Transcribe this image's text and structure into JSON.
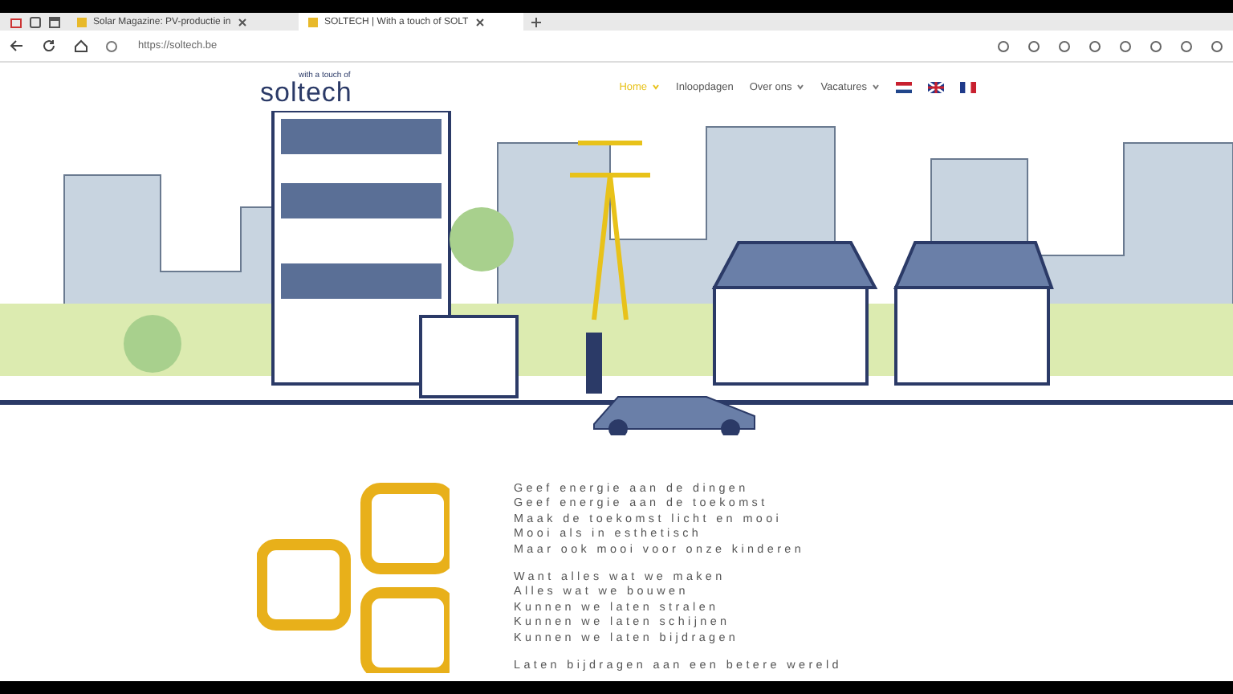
{
  "browser": {
    "tabs": [
      {
        "label": "Solar Magazine: PV-productie in",
        "selected": false
      },
      {
        "label": "SOLTECH | With a touch of SOLT",
        "selected": true
      }
    ],
    "url": "https://soltech.be"
  },
  "site": {
    "logo_tagline": "with a touch of",
    "logo_name": "soltech",
    "nav": [
      {
        "label": "Home",
        "selected": true,
        "dropdown": true
      },
      {
        "label": "Inloopdagen",
        "selected": false,
        "dropdown": false
      },
      {
        "label": "Over ons",
        "selected": false,
        "dropdown": true
      },
      {
        "label": "Vacatures",
        "selected": false,
        "dropdown": true
      }
    ],
    "languages": [
      {
        "kind": "nl"
      },
      {
        "kind": "gb"
      },
      {
        "kind": "fr"
      }
    ]
  },
  "poem": {
    "stanzas": [
      [
        "Geef energie aan de dingen",
        "Geef energie aan de toekomst",
        "Maak de toekomst licht en mooi",
        "Mooi als in esthetisch",
        "Maar ook mooi voor onze kinderen"
      ],
      [
        "Want alles wat we maken",
        "Alles wat we bouwen",
        "Kunnen we laten stralen",
        "Kunnen we laten schijnen",
        "Kunnen we laten bijdragen"
      ],
      [
        "Laten bijdragen aan een betere wereld"
      ]
    ]
  }
}
